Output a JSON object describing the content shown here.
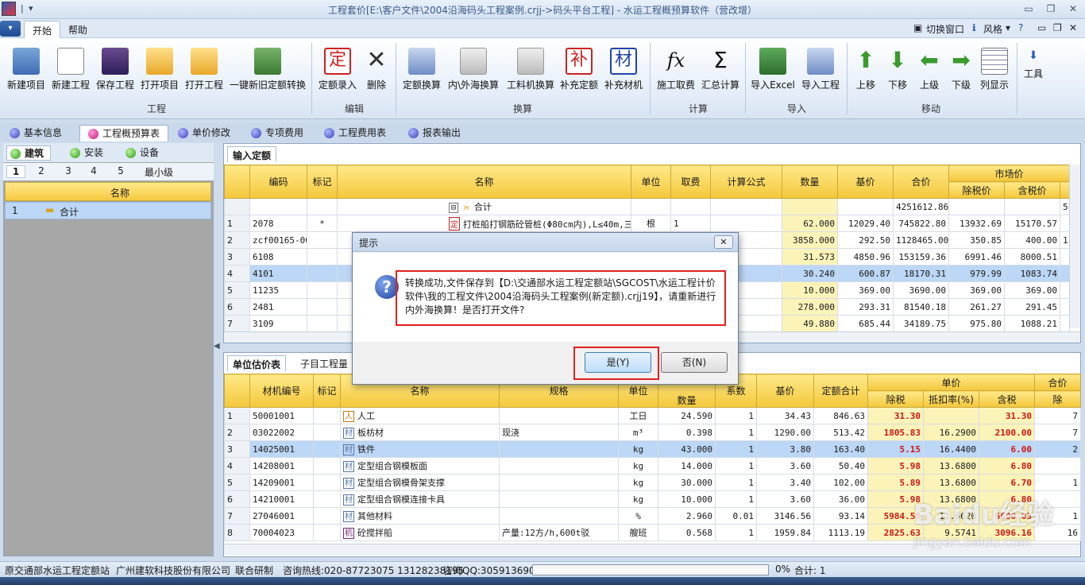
{
  "window": {
    "title": "工程套价[E:\\客户文件\\2004沿海码头工程案例.crjj->码头平台工程] - 水运工程概预算软件（营改增）"
  },
  "menu": {
    "tabs": [
      "开始",
      "帮助"
    ],
    "right_tools": [
      "切换窗口",
      "风格",
      "?"
    ]
  },
  "ribbon": {
    "groups": [
      {
        "label": "工程",
        "buttons": [
          "新建项目",
          "新建工程",
          "保存工程",
          "打开项目",
          "打开工程",
          "一键新旧定额转换"
        ]
      },
      {
        "label": "编辑",
        "buttons": [
          "定额录入",
          "删除"
        ]
      },
      {
        "label": "换算",
        "buttons": [
          "定额换算",
          "内\\外海换算",
          "工料机换算",
          "补充定额",
          "补充材机"
        ]
      },
      {
        "label": "计算",
        "buttons": [
          "施工取费",
          "汇总计算"
        ]
      },
      {
        "label": "导入",
        "buttons": [
          "导入Excel",
          "导入工程"
        ]
      },
      {
        "label": "移动",
        "buttons": [
          "上移",
          "下移",
          "上级",
          "下级",
          "列显示"
        ]
      }
    ],
    "tool_label": "工具",
    "icon_glyphs": {
      "ding": "定",
      "bu": "补",
      "cai": "材",
      "fx": "fx",
      "sigma": "Σ"
    }
  },
  "nav_tabs": [
    "基本信息",
    "工程概预算表",
    "单价修改",
    "专项费用",
    "工程费用表",
    "报表输出"
  ],
  "left": {
    "subtabs": [
      "建筑",
      "安装",
      "设备"
    ],
    "levels": [
      "1",
      "2",
      "3",
      "4",
      "5",
      "最小级"
    ],
    "header": "名称",
    "rows": [
      {
        "n": "1",
        "name": "合计"
      }
    ]
  },
  "upper": {
    "tab": "输入定额",
    "headers": [
      "编码",
      "标记",
      "名称",
      "单位",
      "取费",
      "计算公式",
      "数量",
      "基价",
      "合价",
      "市场价",
      "除税价",
      "含税价"
    ],
    "total_row": {
      "name": "合计",
      "amount": "4251612.86",
      "extra": "5"
    },
    "rows": [
      {
        "n": "1",
        "code": "2078",
        "mark": "*",
        "name": "打桩船打钢筋砼管桩(Φ80cm内),L≤40m,三级土",
        "unit": "根",
        "fee": "1",
        "qty": "62.000",
        "base": "12029.40",
        "total": "745822.80",
        "p1": "13932.69",
        "p2": "15170.57"
      },
      {
        "n": "2",
        "code": "zcf00165-00",
        "mark": "",
        "name": "",
        "unit": "",
        "fee": "",
        "qty": "3858.000",
        "base": "292.50",
        "total": "1128465.00",
        "p1": "350.85",
        "p2": "400.00",
        "tail": "1"
      },
      {
        "n": "3",
        "code": "6108",
        "mark": "",
        "name": "",
        "unit": "",
        "fee": "",
        "qty": "31.573",
        "base": "4850.96",
        "total": "153159.36",
        "p1": "6991.46",
        "p2": "8000.51"
      },
      {
        "n": "4",
        "code": "4101",
        "mark": "",
        "name": "",
        "unit": "",
        "fee": "",
        "qty": "30.240",
        "base": "600.87",
        "total": "18170.31",
        "p1": "979.99",
        "p2": "1083.74"
      },
      {
        "n": "5",
        "code": "11235",
        "mark": "",
        "name": "",
        "unit": "",
        "fee": "",
        "qty": "10.000",
        "base": "369.00",
        "total": "3690.00",
        "p1": "369.00",
        "p2": "369.00"
      },
      {
        "n": "6",
        "code": "2481",
        "mark": "",
        "name": "",
        "unit": "",
        "fee": "",
        "qty": "278.000",
        "base": "293.31",
        "total": "81540.18",
        "p1": "261.27",
        "p2": "291.45"
      },
      {
        "n": "7",
        "code": "3109",
        "mark": "",
        "name": "",
        "unit": "",
        "fee": "",
        "qty": "49.880",
        "base": "685.44",
        "total": "34189.75",
        "p1": "975.80",
        "p2": "1088.21"
      }
    ]
  },
  "lower": {
    "tabs": [
      "单位估价表",
      "子目工程量"
    ],
    "headers": [
      "材机编号",
      "标记",
      "名称",
      "规格",
      "单位",
      "数量",
      "系数",
      "基价",
      "定额合计",
      "单价",
      "除税",
      "抵扣率(%)",
      "含税",
      "合价",
      "除"
    ],
    "rows": [
      {
        "n": "1",
        "code": "50001001",
        "tag": "人",
        "name": "人工",
        "spec": "",
        "unit": "工日",
        "qty": "24.590",
        "coef": "1",
        "base": "34.43",
        "sum": "846.63",
        "p1": "31.30",
        "rate": "",
        "p2": "31.30",
        "tail": "7"
      },
      {
        "n": "2",
        "code": "03022002",
        "tag": "材",
        "name": "板枋材",
        "spec": "现浇",
        "unit": "m³",
        "qty": "0.398",
        "coef": "1",
        "base": "1290.00",
        "sum": "513.42",
        "p1": "1805.83",
        "rate": "16.2900",
        "p2": "2100.00",
        "tail": "7"
      },
      {
        "n": "3",
        "code": "14025001",
        "tag": "材",
        "name": "铁件",
        "spec": "",
        "unit": "kg",
        "qty": "43.000",
        "coef": "1",
        "base": "3.80",
        "sum": "163.40",
        "p1": "5.15",
        "rate": "16.4400",
        "p2": "6.00",
        "tail": "2"
      },
      {
        "n": "4",
        "code": "14208001",
        "tag": "材",
        "name": "定型组合钢模板面",
        "spec": "",
        "unit": "kg",
        "qty": "14.000",
        "coef": "1",
        "base": "3.60",
        "sum": "50.40",
        "p1": "5.98",
        "rate": "13.6800",
        "p2": "6.80",
        "tail": ""
      },
      {
        "n": "5",
        "code": "14209001",
        "tag": "材",
        "name": "定型组合钢模骨架支撑",
        "spec": "",
        "unit": "kg",
        "qty": "30.000",
        "coef": "1",
        "base": "3.40",
        "sum": "102.00",
        "p1": "5.89",
        "rate": "13.6800",
        "p2": "6.70",
        "tail": "1"
      },
      {
        "n": "6",
        "code": "14210001",
        "tag": "材",
        "name": "定型组合钢模连接卡具",
        "spec": "",
        "unit": "kg",
        "qty": "10.000",
        "coef": "1",
        "base": "3.60",
        "sum": "36.00",
        "p1": "5.98",
        "rate": "13.6800",
        "p2": "6.80",
        "tail": ""
      },
      {
        "n": "7",
        "code": "27046001",
        "tag": "材",
        "name": "其他材料",
        "spec": "",
        "unit": "%",
        "qty": "2.960",
        "coef": "0.01",
        "base": "3146.56",
        "sum": "93.14",
        "p1": "5984.58",
        "rate": "11.6620",
        "p2": "6680.03",
        "tail": "1"
      },
      {
        "n": "8",
        "code": "70004023",
        "tag": "机",
        "name": "砼搅拌船",
        "spec": "产量:12方/h,600t驳",
        "unit": "艘班",
        "qty": "0.568",
        "coef": "1",
        "base": "1959.84",
        "sum": "1113.19",
        "p1": "2825.63",
        "rate": "9.5741",
        "p2": "3096.16",
        "tail": "16"
      }
    ]
  },
  "dialog": {
    "title": "提示",
    "close": "✕",
    "message": "转换成功,文件保存到【D:\\交通部水运工程定额站\\SGCOST\\水运工程计价软件\\我的工程文件\\2004沿海码头工程案例(新定额).crjj19】，请重新进行内外海换算！是否打开文件?",
    "yes": "是(Y)",
    "no": "否(N)"
  },
  "status": {
    "org": "原交通部水运工程定额站",
    "company": "广州建软科技股份有限公司",
    "cooperate": "联合研制",
    "hotline": "咨询热线:020-87723075 13128238195",
    "qq": "咨询QQ:3059136902",
    "progress_pct": "0%",
    "total": "合计: 1"
  },
  "watermark": {
    "logo": "Baidu经验",
    "site": "jingyan.baidu.com"
  }
}
